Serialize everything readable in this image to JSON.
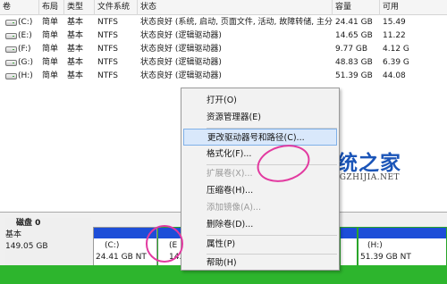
{
  "columns": [
    "卷",
    "布局",
    "类型",
    "文件系统",
    "状态",
    "容量",
    "可用"
  ],
  "volumes": [
    {
      "name": "(C:)",
      "layout": "简单",
      "type": "基本",
      "fs": "NTFS",
      "status": "状态良好 (系统, 启动, 页面文件, 活动, 故障转储, 主分区)",
      "capacity": "24.41 GB",
      "free": "15.49"
    },
    {
      "name": "(E:)",
      "layout": "简单",
      "type": "基本",
      "fs": "NTFS",
      "status": "状态良好 (逻辑驱动器)",
      "capacity": "14.65 GB",
      "free": "11.22"
    },
    {
      "name": "(F:)",
      "layout": "简单",
      "type": "基本",
      "fs": "NTFS",
      "status": "状态良好 (逻辑驱动器)",
      "capacity": "9.77 GB",
      "free": "4.12 G"
    },
    {
      "name": "(G:)",
      "layout": "简单",
      "type": "基本",
      "fs": "NTFS",
      "status": "状态良好 (逻辑驱动器)",
      "capacity": "48.83 GB",
      "free": "6.39 G"
    },
    {
      "name": "(H:)",
      "layout": "简单",
      "type": "基本",
      "fs": "NTFS",
      "status": "状态良好 (逻辑驱动器)",
      "capacity": "51.39 GB",
      "free": "44.08"
    }
  ],
  "context_menu": {
    "items": [
      {
        "label": "打开(O)",
        "enabled": true
      },
      {
        "label": "资源管理器(E)",
        "enabled": true
      },
      {
        "label": "更改驱动器号和路径(C)...",
        "enabled": true,
        "highlighted": true
      },
      {
        "label": "格式化(F)...",
        "enabled": true
      },
      {
        "label": "扩展卷(X)...",
        "enabled": false
      },
      {
        "label": "压缩卷(H)...",
        "enabled": true
      },
      {
        "label": "添加镜像(A)...",
        "enabled": false
      },
      {
        "label": "删除卷(D)...",
        "enabled": true
      },
      {
        "label": "属性(P)",
        "enabled": true
      },
      {
        "label": "帮助(H)",
        "enabled": true
      }
    ]
  },
  "disk": {
    "label": "磁盘 0",
    "type": "基本",
    "size": "149.05 GB"
  },
  "partitions": [
    {
      "letter": "(C:)",
      "size": "24.41 GB NT"
    },
    {
      "letter": "(E",
      "size": "14."
    },
    {
      "letter": "(H:)",
      "size": "51.39 GB NT"
    }
  ],
  "watermark": {
    "cn": "系统之家",
    "en": "XITONGZHIJIA.NET"
  },
  "colors": {
    "primary_partition_bar": "#1d4ed8",
    "logical_partition_bar": "#2aa52a",
    "menu_highlight": "#d9e8fb",
    "annotation_circle": "#e23aa0",
    "bottom_strip": "#2db52d"
  }
}
